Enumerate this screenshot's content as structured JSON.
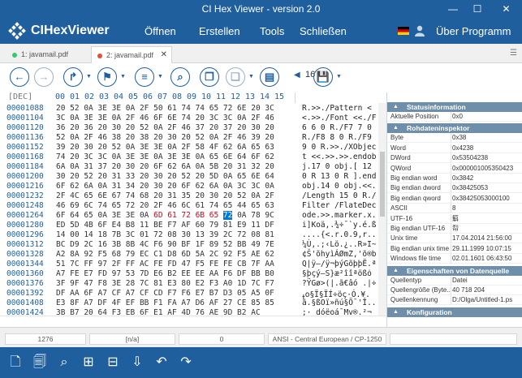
{
  "window": {
    "title": "CI Hex Viewer - version 2.0",
    "min": "—",
    "max": "☐",
    "close": "✕"
  },
  "app": {
    "name": "CIHexViewer"
  },
  "menu": [
    {
      "label": "Öffnen"
    },
    {
      "label": "Erstellen"
    },
    {
      "label": "Tools"
    },
    {
      "label": "Schließen"
    },
    {
      "label": "Über Programm"
    }
  ],
  "tabs": [
    {
      "label": "1: javamail.pdf",
      "dot": "#2ecc71",
      "active": false
    },
    {
      "label": "2: javamail.pdf",
      "dot": "#e74c3c",
      "active": true,
      "close": "✕"
    }
  ],
  "toolbar": {
    "bytes_per_row": "16",
    "icons": [
      "back-icon",
      "forward-icon",
      "redo-icon",
      "bookmark-icon",
      "list-icon",
      "search-icon",
      "copy-icon",
      "pages-icon",
      "save-icon"
    ]
  },
  "hexview": {
    "dec_label": "[DEC]",
    "columns": [
      "00",
      "01",
      "02",
      "03",
      "04",
      "05",
      "06",
      "07",
      "08",
      "09",
      "10",
      "11",
      "12",
      "13",
      "14",
      "15"
    ],
    "rows": [
      {
        "addr": "00001088",
        "hex": "20 52 0A 3E 3E 0A 2F 50 61 74 74 65 72 6E 20 3C",
        "ascii": " R.>>./Pattern <"
      },
      {
        "addr": "00001104",
        "hex": "3C 0A 3E 3E 0A 2F 46 6F 6E 74 20 3C 3C 0A 2F 46",
        "ascii": "<.>>./Font <<./F"
      },
      {
        "addr": "00001120",
        "hex": "36 20 36 20 30 20 52 0A 2F 46 37 20 37 20 30 20",
        "ascii": "6 6 0 R./F7 7 0 "
      },
      {
        "addr": "00001136",
        "hex": "52 0A 2F 46 38 20 38 20 30 20 52 0A 2F 46 39 20",
        "ascii": "R./F8 8 0 R./F9 "
      },
      {
        "addr": "00001152",
        "hex": "39 20 30 20 52 0A 3E 3E 0A 2F 58 4F 62 6A 65 63",
        "ascii": "9 0 R.>>./XObjec"
      },
      {
        "addr": "00001168",
        "hex": "74 20 3C 3C 0A 3E 3E 0A 3E 3E 0A 65 6E 64 6F 62",
        "ascii": "t <<.>>.>>.endob"
      },
      {
        "addr": "00001184",
        "hex": "6A 0A 31 37 20 30 20 6F 62 6A 0A 5B 20 31 32 20",
        "ascii": "j.17 0 obj.[ 12 "
      },
      {
        "addr": "00001200",
        "hex": "30 20 52 20 31 33 20 30 20 52 20 5D 0A 65 6E 64",
        "ascii": "0 R 13 0 R ].end"
      },
      {
        "addr": "00001216",
        "hex": "6F 62 6A 0A 31 34 20 30 20 6F 62 6A 0A 3C 3C 0A",
        "ascii": "obj.14 0 obj.<<."
      },
      {
        "addr": "00001232",
        "hex": "2F 4C 65 6E 67 74 68 20 31 35 20 30 20 52 0A 2F",
        "ascii": "/Length 15 0 R./"
      },
      {
        "addr": "00001248",
        "hex": "46 69 6C 74 65 72 20 2F 46 6C 61 74 65 44 65 63",
        "ascii": "Filter /FlateDec"
      },
      {
        "addr": "00001264",
        "hex": "6F 64 65 0A 3E 3E 0A ",
        "hl": "6D 61 72 6B 65 ",
        "sel": "72",
        "hex2": " 0A 78 9C",
        "ascii": "ode.>>.marker.x."
      },
      {
        "addr": "00001280",
        "hex": "ED 5D 4B 6F E4 B8 11 BE F7 AF 60 79 81 E9 11 DF",
        "ascii": "i]Koä,.¾÷¯`y.é.ß"
      },
      {
        "addr": "00001296",
        "hex": "14 00 14 18 7B 3C 01 72 08 30 13 39 2C 72 08 81",
        "ascii": "....{<.r.0.9,r.."
      },
      {
        "addr": "00001312",
        "hex": "BC D9 2C 16 3B 8B 4C F6 90 BF 1F 89 52 BB 49 7E",
        "ascii": "¼Ù,.;‹Lö.¿..R»I~"
      },
      {
        "addr": "00001328",
        "addr2": "",
        "hex": "A2 8A 92 F5 68 79 EC C1 D8 6D 5A 2C 92 F5 AE 62",
        "ascii": "¢Š'õhyìÁØmZ,'õ®b"
      },
      {
        "addr": "00001344",
        "hex": "51 7C FF 97 2F FF AC FE FD 47 F5 FE FE CB 7F AA",
        "ascii": "Q|ÿ—/ÿ¬þýGõþþË.ª"
      },
      {
        "addr": "00001360",
        "hex": "A7 FE E7 FD 97 53 7D E6 B2 EE EE AA F6 DF BB B0",
        "ascii": "§þçý—S}æ²îîªößȯ"
      },
      {
        "addr": "00001376",
        "hex": "3F 9F 47 F8 3E 28 7C 81 E3 80 E2 F3 A0 1D 7C F7",
        "ascii": "?ŸGø>(|.ã€âó .|÷"
      },
      {
        "addr": "00001392",
        "hex": "DF AA 6F A7 CF A7 CF CD F7 F6 E7 B7 D3 05 A5 0F",
        "ascii": "ߪo§Ï§ÏÍ÷öç·Ó.¥."
      },
      {
        "addr": "00001408",
        "hex": "E3 8F A7 DF 4F EF BB F1 FA A7 D6 AF 27 CE 85 85",
        "ascii": "ã.§ßOï»ñú§Ö¯'Î.."
      },
      {
        "addr": "00001424",
        "hex": "3B B7 20 64 F3 EB 6F E1 AF 4D 76 AE 9D B2 AC",
        "ascii": ";· dóëoá¯Mv®.²¬"
      }
    ]
  },
  "panel": {
    "sections": [
      {
        "title": "Statusinformation",
        "props": [
          {
            "k": "Aktuelle Position",
            "v": "0x0"
          }
        ]
      },
      {
        "title": "Rohdateninspektor",
        "props": [
          {
            "k": "Byte",
            "v": "0x38"
          },
          {
            "k": "Word",
            "v": "0x4238"
          },
          {
            "k": "DWord",
            "v": "0x53504238"
          },
          {
            "k": "QWord",
            "v": "0x000001005350423"
          },
          {
            "k": "Big endian word",
            "v": "0x3842"
          },
          {
            "k": "Big endian dword",
            "v": "0x38425053"
          },
          {
            "k": "Big endian qword",
            "v": "0x38425053000100"
          },
          {
            "k": "ASCII",
            "v": "8"
          },
          {
            "k": "UTF-16",
            "v": "䈸"
          },
          {
            "k": "Big endian UTF-16",
            "v": "㡂"
          },
          {
            "k": "Unix time",
            "v": "17.04.2014 21:56:00"
          },
          {
            "k": "Big endian unix time",
            "v": "29.11.1999 10:07:15"
          },
          {
            "k": "Windows file time",
            "v": "02.01.1601 06:43:50"
          }
        ]
      },
      {
        "title": "Eigenschaften von Datenquelle",
        "props": [
          {
            "k": "Quellentyp",
            "v": "Datei"
          },
          {
            "k": "Quellengröße (Byte...",
            "v": "40 718 204"
          },
          {
            "k": "Quellenkennung",
            "v": "D:/Olga/Untitled-1.ps"
          }
        ]
      },
      {
        "title": "Konfiguration",
        "props": []
      }
    ]
  },
  "status": {
    "position": "1276",
    "selection": "[n/a]",
    "value": "0",
    "encoding": "ANSI - Central European / CP-1250"
  },
  "bottom_icons": [
    "open-file-icon",
    "open-files-icon",
    "search-replace-icon",
    "add-page-icon",
    "insert-icon",
    "export-icon",
    "undo-icon",
    "redo-icon"
  ],
  "colors": {
    "brand": "#1f5f9e",
    "section": "#6f8ea9",
    "highlight": "#d0021b",
    "selection": "#0078d7"
  }
}
